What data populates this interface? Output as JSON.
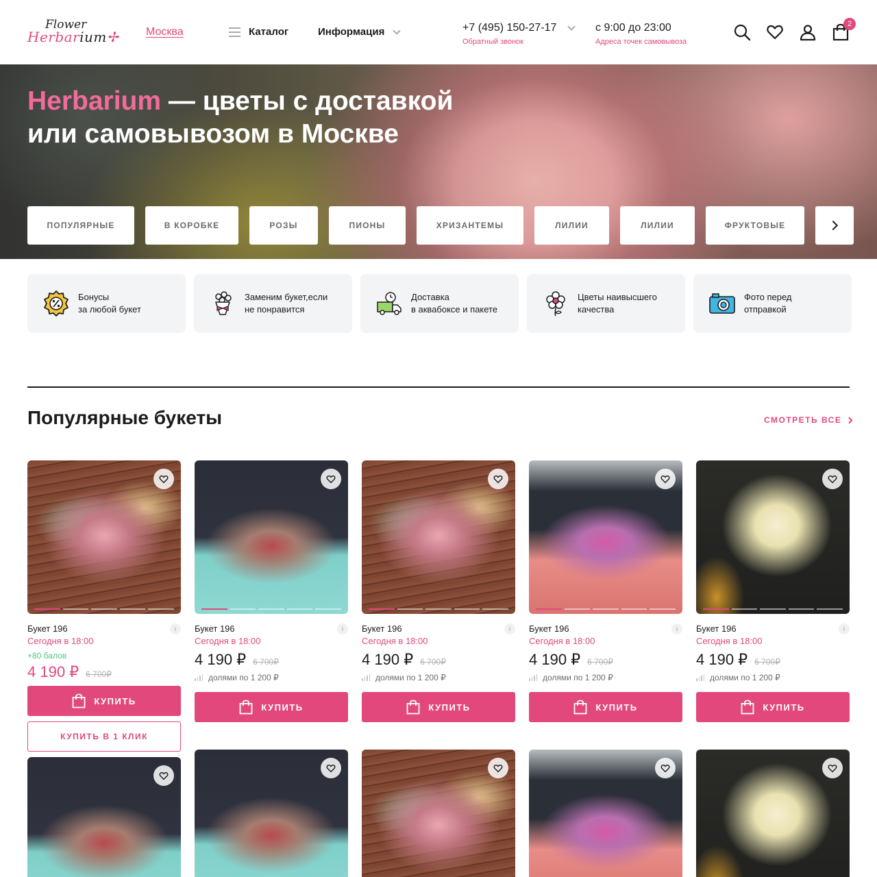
{
  "header": {
    "logo_top": "Flower",
    "logo_bottom_pink": "Herbar",
    "logo_bottom_dark": "ium",
    "city": "Москва",
    "catalog": "Каталог",
    "info": "Информация",
    "phone": "+7 (495) 150-27-17",
    "callback": "Обратный звонок",
    "hours": "с 9:00 до 23:00",
    "pickup": "Адреса точек самовывоза",
    "cart_count": "2"
  },
  "hero": {
    "brand": "Herbarium",
    "title_rest": " — цветы с доставкой или самовывозом в Москве"
  },
  "categories": [
    "ПОПУЛЯРНЫЕ",
    "В КОРОБКЕ",
    "РОЗЫ",
    "ПИОНЫ",
    "ХРИЗАНТЕМЫ",
    "ЛИЛИИ",
    "ЛИЛИИ",
    "ФРУКТОВЫЕ"
  ],
  "features": [
    {
      "icon": "bonus-percent-icon",
      "line1": "Бонусы",
      "line2": "за любой букет"
    },
    {
      "icon": "bouquet-icon",
      "line1": "Заменим букет,если",
      "line2": "не понравится"
    },
    {
      "icon": "delivery-truck-icon",
      "line1": "Доставка",
      "line2": "в аквабоксе и пакете"
    },
    {
      "icon": "flower-icon",
      "line1": "Цветы наивысшего",
      "line2": "качества"
    },
    {
      "icon": "camera-icon",
      "line1": "Фото перед",
      "line2": "отправкой"
    }
  ],
  "section": {
    "title": "Популярные букеты",
    "see_all": "СМОТРЕТЬ ВСЕ"
  },
  "products": [
    {
      "name": "Букет 196",
      "date": "Сегодня в 18:00",
      "bonus": "+80 балов",
      "price": "4 190 ₽",
      "old_price": "6 700₽",
      "split": "",
      "buy": "КУПИТЬ",
      "one_click": "КУПИТЬ В 1 КЛИК",
      "photo": "wood"
    },
    {
      "name": "Букет 196",
      "date": "Сегодня в 18:00",
      "bonus": "",
      "price": "4 190 ₽",
      "old_price": "6 700₽",
      "split": "долями по 1 200 ₽",
      "buy": "КУПИТЬ",
      "one_click": "",
      "photo": "blue"
    },
    {
      "name": "Букет 196",
      "date": "Сегодня в 18:00",
      "bonus": "",
      "price": "4 190 ₽",
      "old_price": "6 700₽",
      "split": "долями по 1 200 ₽",
      "buy": "КУПИТЬ",
      "one_click": "",
      "photo": "wood"
    },
    {
      "name": "Букет 196",
      "date": "Сегодня в 18:00",
      "bonus": "",
      "price": "4 190 ₽",
      "old_price": "6 700₽",
      "split": "долями по 1 200 ₽",
      "buy": "КУПИТЬ",
      "one_click": "",
      "photo": "crate"
    },
    {
      "name": "Букет 196",
      "date": "Сегодня в 18:00",
      "bonus": "",
      "price": "4 190 ₽",
      "old_price": "6 700₽",
      "split": "долями по 1 200 ₽",
      "buy": "КУПИТЬ",
      "one_click": "",
      "photo": "dark"
    }
  ],
  "products_row2_photos": [
    "blue",
    "blue",
    "wood",
    "crate",
    "dark"
  ],
  "colors": {
    "accent": "#e2487c",
    "bonus": "#4cc97a"
  }
}
